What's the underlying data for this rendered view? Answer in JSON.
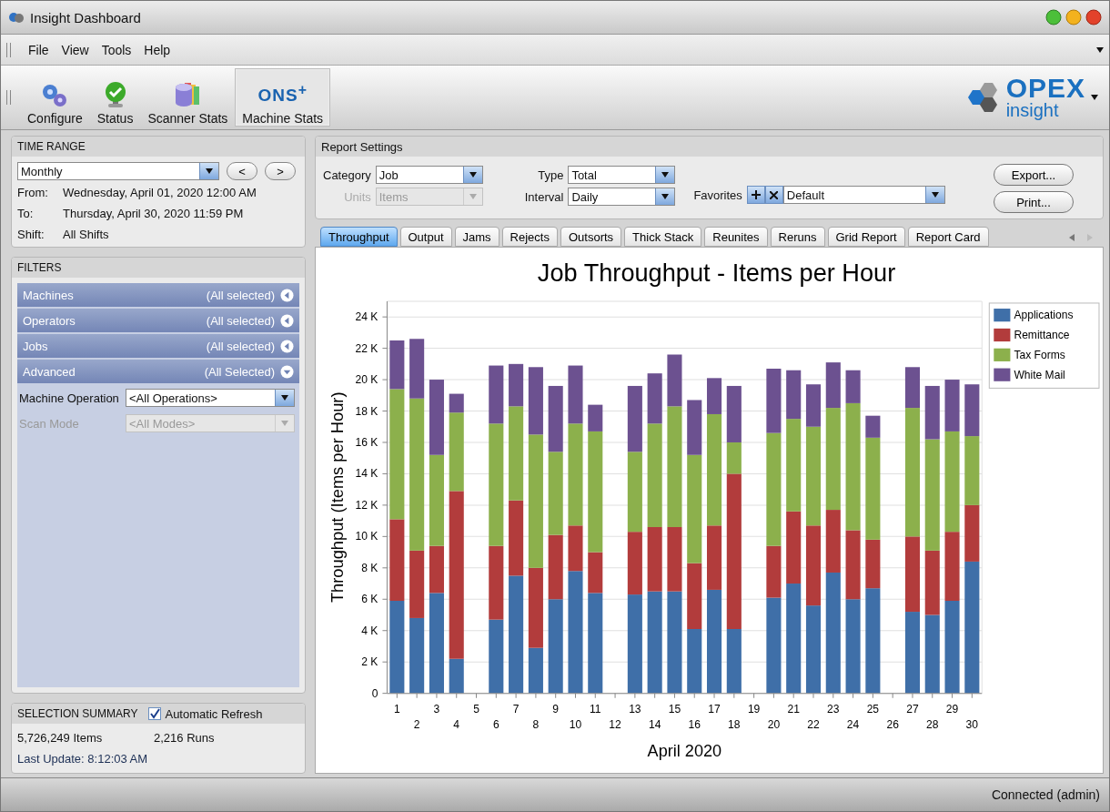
{
  "window": {
    "title": "Insight Dashboard"
  },
  "menu": [
    "File",
    "View",
    "Tools",
    "Help"
  ],
  "toolbar": [
    {
      "label": "Configure",
      "kind": "gears",
      "selected": false
    },
    {
      "label": "Status",
      "kind": "status",
      "selected": false
    },
    {
      "label": "Scanner Stats",
      "kind": "stack",
      "selected": false
    },
    {
      "label": "Machine Stats",
      "kind": "logo",
      "logo_text": "ONS$^{+}$",
      "selected": true
    }
  ],
  "brand": {
    "name": "OPEX",
    "sub": "insight"
  },
  "time_range": {
    "title": "TIME RANGE",
    "period": "Monthly",
    "prev": "<",
    "next": ">",
    "rows": [
      {
        "label": "From:",
        "value": "Wednesday, April 01, 2020 12:00 AM"
      },
      {
        "label": "To:",
        "value": "Thursday, April 30, 2020 11:59 PM"
      },
      {
        "label": "Shift:",
        "value": "All Shifts"
      }
    ]
  },
  "filters": {
    "title": "FILTERS",
    "groups": [
      {
        "name": "Machines",
        "summary": "(All selected)",
        "expanded": false
      },
      {
        "name": "Operators",
        "summary": "(All selected)",
        "expanded": false
      },
      {
        "name": "Jobs",
        "summary": "(All selected)",
        "expanded": false
      },
      {
        "name": "Advanced",
        "summary": "(All Selected)",
        "expanded": true
      }
    ],
    "fields": [
      {
        "label": "Machine Operation",
        "value": "<All Operations>",
        "disabled": false
      },
      {
        "label": "Scan Mode",
        "value": "<All Modes>",
        "disabled": true
      }
    ]
  },
  "selection_summary": {
    "title": "SELECTION SUMMARY",
    "auto_refresh": {
      "label": "Automatic Refresh",
      "checked": true
    },
    "items": "5,726,249 Items",
    "runs": "2,216 Runs",
    "last_update": "Last Update: 8:12:03 AM"
  },
  "report_settings": {
    "title": "Report Settings",
    "fields": [
      {
        "label": "Category",
        "value": "Job",
        "disabled": false
      },
      {
        "label": "Units",
        "value": "Items",
        "disabled": true
      },
      {
        "label": "Type",
        "value": "Total",
        "disabled": false
      },
      {
        "label": "Interval",
        "value": "Daily",
        "disabled": false
      }
    ],
    "favorites": {
      "label": "Favorites",
      "value": "Default"
    },
    "buttons": [
      "Export...",
      "Print..."
    ]
  },
  "tabs": [
    {
      "label": "Throughput",
      "selected": true
    },
    {
      "label": "Output",
      "selected": false
    },
    {
      "label": "Jams",
      "selected": false
    },
    {
      "label": "Rejects",
      "selected": false
    },
    {
      "label": "Outsorts",
      "selected": false
    },
    {
      "label": "Thick Stack",
      "selected": false
    },
    {
      "label": "Reunites",
      "selected": false
    },
    {
      "label": "Reruns",
      "selected": false
    },
    {
      "label": "Grid Report",
      "selected": false
    },
    {
      "label": "Report Card",
      "selected": false
    }
  ],
  "chart": {
    "chart_data": {
      "type": "bar",
      "stacked": true,
      "title": "Job Throughput - Items per Hour",
      "xlabel": "April 2020",
      "ylabel": "Throughput (Items per Hour)",
      "categories": [
        "1",
        "2",
        "3",
        "4",
        "5",
        "6",
        "7",
        "8",
        "9",
        "10",
        "11",
        "12",
        "13",
        "14",
        "15",
        "16",
        "17",
        "18",
        "19",
        "20",
        "21",
        "22",
        "23",
        "24",
        "25",
        "26",
        "27",
        "28",
        "29",
        "30"
      ],
      "ylim": [
        0,
        25000
      ],
      "grid": {
        "y": true
      },
      "legend": true,
      "yticks": [
        {
          "value": 0,
          "label": "0"
        },
        {
          "value": 2000,
          "label": "2 K"
        },
        {
          "value": 4000,
          "label": "4 K"
        },
        {
          "value": 6000,
          "label": "6 K"
        },
        {
          "value": 8000,
          "label": "8 K"
        },
        {
          "value": 10000,
          "label": "10 K"
        },
        {
          "value": 12000,
          "label": "12 K"
        },
        {
          "value": 14000,
          "label": "14 K"
        },
        {
          "value": 16000,
          "label": "16 K"
        },
        {
          "value": 18000,
          "label": "18 K"
        },
        {
          "value": 20000,
          "label": "20 K"
        },
        {
          "value": 22000,
          "label": "22 K"
        },
        {
          "value": 24000,
          "label": "24 K"
        }
      ],
      "series": [
        {
          "name": "Applications",
          "color": "#3f6fa8",
          "values": [
            5900,
            4800,
            6400,
            2200,
            null,
            4700,
            7500,
            2900,
            6000,
            7800,
            6400,
            null,
            6300,
            6500,
            6500,
            4100,
            6600,
            4100,
            null,
            6100,
            7000,
            5600,
            7700,
            6000,
            6700,
            null,
            5200,
            5000,
            5900,
            8400
          ]
        },
        {
          "name": "Remittance",
          "color": "#b23c3c",
          "values": [
            5200,
            4300,
            3000,
            10700,
            null,
            4700,
            4800,
            5100,
            4100,
            2900,
            2600,
            null,
            4000,
            4100,
            4100,
            4200,
            4100,
            9900,
            null,
            3300,
            4600,
            5100,
            4000,
            4400,
            3100,
            null,
            4800,
            4100,
            4400,
            3600
          ]
        },
        {
          "name": "Tax Forms",
          "color": "#8cb04c",
          "values": [
            8300,
            9700,
            5800,
            5000,
            null,
            7800,
            6000,
            8500,
            5300,
            6500,
            7700,
            null,
            5100,
            6600,
            7700,
            6900,
            7100,
            2000,
            null,
            7200,
            5900,
            6300,
            6500,
            8100,
            6500,
            null,
            8200,
            7100,
            6400,
            4400
          ]
        },
        {
          "name": "White Mail",
          "color": "#6c5190",
          "values": [
            3100,
            3800,
            4800,
            1200,
            null,
            3700,
            2700,
            4300,
            4200,
            3700,
            1700,
            null,
            4200,
            3200,
            3300,
            3500,
            2300,
            3600,
            null,
            4100,
            3100,
            2700,
            2900,
            2100,
            1400,
            null,
            2600,
            3400,
            3300,
            3300
          ]
        }
      ]
    }
  },
  "status_bar": {
    "text": "Connected (admin)"
  }
}
